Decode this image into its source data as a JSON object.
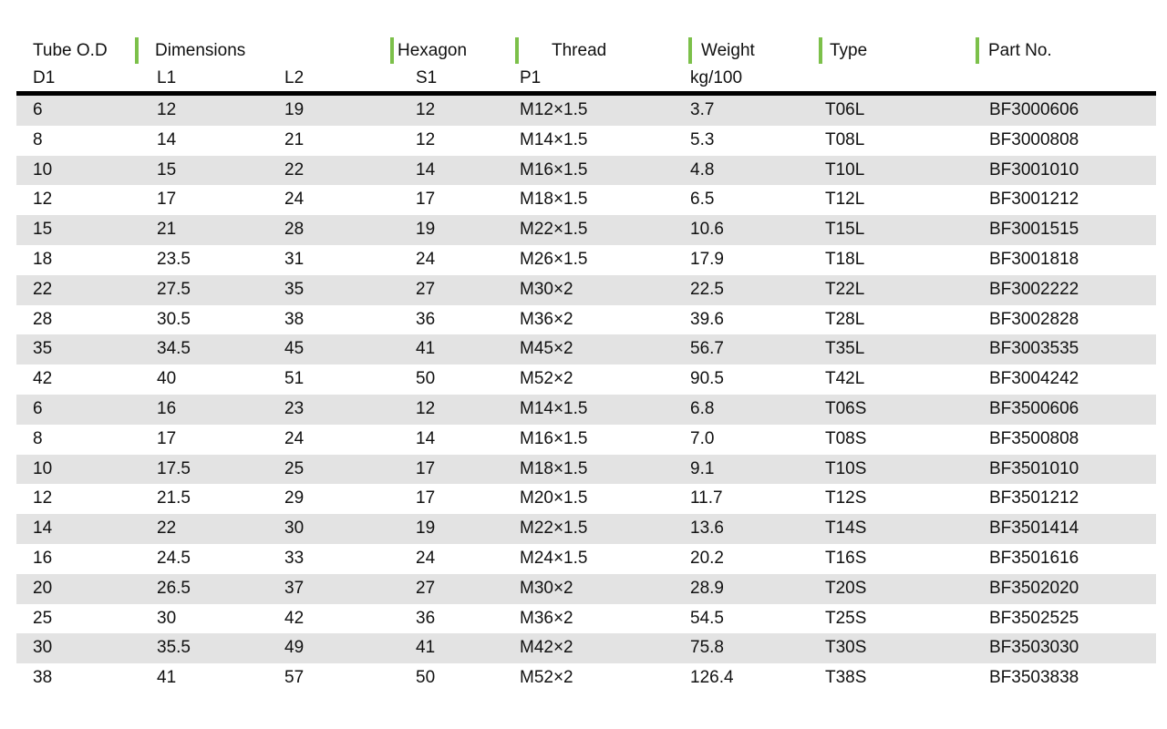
{
  "table": {
    "header": {
      "groups": [
        {
          "label": "Tube O.D",
          "bar": false,
          "left": 36,
          "label_pad": 0
        },
        {
          "label": "Dimensions",
          "bar": true,
          "left": 148,
          "label_pad": 18
        },
        {
          "label": "Hexagon",
          "bar": true,
          "left": 428,
          "label_pad": 4
        },
        {
          "label": "Thread",
          "bar": true,
          "left": 565,
          "label_pad": 36
        },
        {
          "label": "Weight",
          "bar": true,
          "left": 755,
          "label_pad": 10
        },
        {
          "label": "Type",
          "bar": true,
          "left": 898,
          "label_pad": 8
        },
        {
          "label": "Part No.",
          "bar": true,
          "left": 1070,
          "label_pad": 10
        }
      ],
      "subheaders": [
        {
          "label": "D1",
          "left": 36
        },
        {
          "label": "L1",
          "left": 172
        },
        {
          "label": "L2",
          "left": 312
        },
        {
          "label": "S1",
          "left": 456
        },
        {
          "label": "P1",
          "left": 570
        },
        {
          "label": "kg/100",
          "left": 757
        }
      ],
      "columns": [
        "D1",
        "L1",
        "L2",
        "S1",
        "P1",
        "kg/100",
        "Type",
        "Part No."
      ]
    },
    "accent_color": "#7cc04a",
    "rule_color": "#000000",
    "band_color": "#e3e3e3",
    "blocks": [
      {
        "series": "L",
        "rows": [
          {
            "d1": "6",
            "l1": "12",
            "l2": "19",
            "s1": "12",
            "p1": "M12×1.5",
            "weight": "3.7",
            "type": "T06L",
            "part": "BF3000606"
          },
          {
            "d1": "8",
            "l1": "14",
            "l2": "21",
            "s1": "12",
            "p1": "M14×1.5",
            "weight": "5.3",
            "type": "T08L",
            "part": "BF3000808"
          },
          {
            "d1": "10",
            "l1": "15",
            "l2": "22",
            "s1": "14",
            "p1": "M16×1.5",
            "weight": "4.8",
            "type": "T10L",
            "part": "BF3001010"
          },
          {
            "d1": "12",
            "l1": "17",
            "l2": "24",
            "s1": "17",
            "p1": "M18×1.5",
            "weight": "6.5",
            "type": "T12L",
            "part": "BF3001212"
          },
          {
            "d1": "15",
            "l1": "21",
            "l2": "28",
            "s1": "19",
            "p1": "M22×1.5",
            "weight": "10.6",
            "type": "T15L",
            "part": "BF3001515"
          },
          {
            "d1": "18",
            "l1": "23.5",
            "l2": "31",
            "s1": "24",
            "p1": "M26×1.5",
            "weight": "17.9",
            "type": "T18L",
            "part": "BF3001818"
          },
          {
            "d1": "22",
            "l1": "27.5",
            "l2": "35",
            "s1": "27",
            "p1": "M30×2",
            "weight": "22.5",
            "type": "T22L",
            "part": "BF3002222"
          },
          {
            "d1": "28",
            "l1": "30.5",
            "l2": "38",
            "s1": "36",
            "p1": "M36×2",
            "weight": "39.6",
            "type": "T28L",
            "part": "BF3002828"
          },
          {
            "d1": "35",
            "l1": "34.5",
            "l2": "45",
            "s1": "41",
            "p1": "M45×2",
            "weight": "56.7",
            "type": "T35L",
            "part": "BF3003535"
          },
          {
            "d1": "42",
            "l1": "40",
            "l2": "51",
            "s1": "50",
            "p1": "M52×2",
            "weight": "90.5",
            "type": "T42L",
            "part": "BF3004242"
          }
        ]
      },
      {
        "series": "S",
        "rows": [
          {
            "d1": "6",
            "l1": "16",
            "l2": "23",
            "s1": "12",
            "p1": "M14×1.5",
            "weight": "6.8",
            "type": "T06S",
            "part": "BF3500606"
          },
          {
            "d1": "8",
            "l1": "17",
            "l2": "24",
            "s1": "14",
            "p1": "M16×1.5",
            "weight": "7.0",
            "type": "T08S",
            "part": "BF3500808"
          },
          {
            "d1": "10",
            "l1": "17.5",
            "l2": "25",
            "s1": "17",
            "p1": "M18×1.5",
            "weight": "9.1",
            "type": "T10S",
            "part": "BF3501010"
          },
          {
            "d1": "12",
            "l1": "21.5",
            "l2": "29",
            "s1": "17",
            "p1": "M20×1.5",
            "weight": "11.7",
            "type": "T12S",
            "part": "BF3501212"
          },
          {
            "d1": "14",
            "l1": "22",
            "l2": "30",
            "s1": "19",
            "p1": "M22×1.5",
            "weight": "13.6",
            "type": "T14S",
            "part": "BF3501414"
          },
          {
            "d1": "16",
            "l1": "24.5",
            "l2": "33",
            "s1": "24",
            "p1": "M24×1.5",
            "weight": "20.2",
            "type": "T16S",
            "part": "BF3501616"
          },
          {
            "d1": "20",
            "l1": "26.5",
            "l2": "37",
            "s1": "27",
            "p1": "M30×2",
            "weight": "28.9",
            "type": "T20S",
            "part": "BF3502020"
          },
          {
            "d1": "25",
            "l1": "30",
            "l2": "42",
            "s1": "36",
            "p1": "M36×2",
            "weight": "54.5",
            "type": "T25S",
            "part": "BF3502525"
          },
          {
            "d1": "30",
            "l1": "35.5",
            "l2": "49",
            "s1": "41",
            "p1": "M42×2",
            "weight": "75.8",
            "type": "T30S",
            "part": "BF3503030"
          },
          {
            "d1": "38",
            "l1": "41",
            "l2": "57",
            "s1": "50",
            "p1": "M52×2",
            "weight": "126.4",
            "type": "T38S",
            "part": "BF3503838"
          }
        ]
      }
    ]
  }
}
